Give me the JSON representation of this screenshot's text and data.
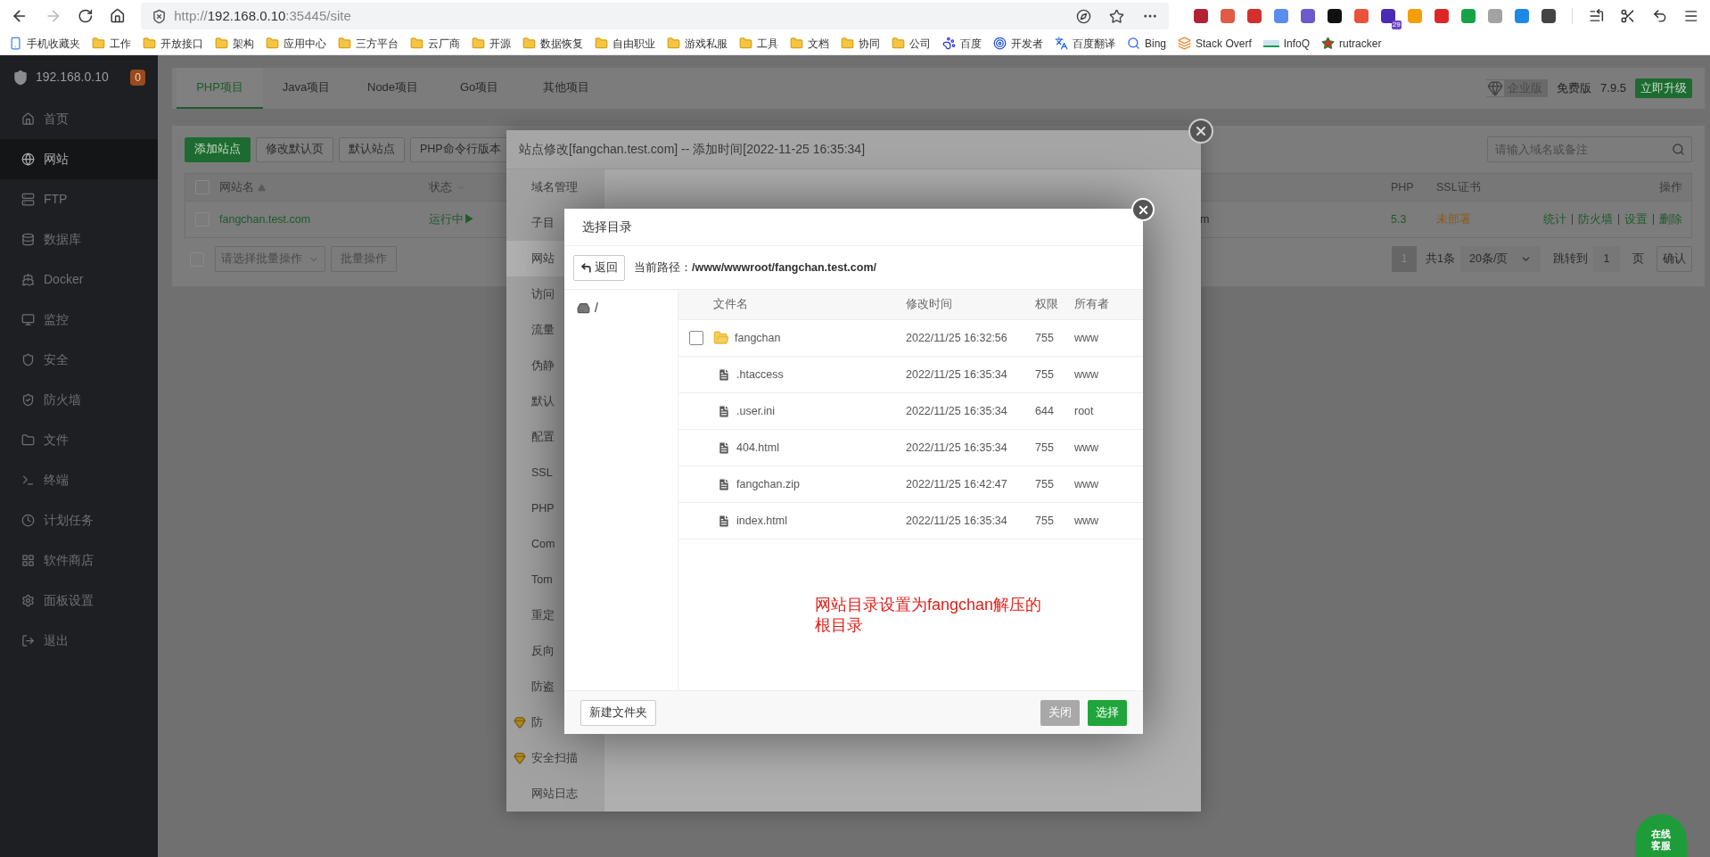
{
  "browser": {
    "url": {
      "scheme": "http://",
      "host": "192.168.0.10",
      "rest": ":35445/site"
    },
    "extension_badge": "29",
    "bookmarks": [
      {
        "label": "手机收藏夹",
        "kind": "device"
      },
      {
        "label": "工作",
        "kind": "folder"
      },
      {
        "label": "开放接口",
        "kind": "folder"
      },
      {
        "label": "架构",
        "kind": "folder"
      },
      {
        "label": "应用中心",
        "kind": "folder"
      },
      {
        "label": "三方平台",
        "kind": "folder"
      },
      {
        "label": "云厂商",
        "kind": "folder"
      },
      {
        "label": "开源",
        "kind": "folder"
      },
      {
        "label": "数据恢复",
        "kind": "folder"
      },
      {
        "label": "自由职业",
        "kind": "folder"
      },
      {
        "label": "游戏私服",
        "kind": "folder"
      },
      {
        "label": "工具",
        "kind": "folder"
      },
      {
        "label": "文档",
        "kind": "folder"
      },
      {
        "label": "协同",
        "kind": "folder"
      },
      {
        "label": "公司",
        "kind": "folder"
      },
      {
        "label": "百度",
        "kind": "paw"
      },
      {
        "label": "开发者",
        "kind": "target"
      },
      {
        "label": "百度翻译",
        "kind": "translate"
      },
      {
        "label": "Bing",
        "kind": "search"
      },
      {
        "label": "Stack Overf",
        "kind": "stack"
      },
      {
        "label": "InfoQ",
        "kind": "infoq"
      },
      {
        "label": "rutracker",
        "kind": "star"
      }
    ]
  },
  "sidebar": {
    "host": "192.168.0.10",
    "badge": "0",
    "items": [
      {
        "label": "首页",
        "selected": false
      },
      {
        "label": "网站",
        "selected": true
      },
      {
        "label": "FTP",
        "selected": false
      },
      {
        "label": "数据库",
        "selected": false
      },
      {
        "label": "Docker",
        "selected": false
      },
      {
        "label": "监控",
        "selected": false
      },
      {
        "label": "安全",
        "selected": false
      },
      {
        "label": "防火墙",
        "selected": false
      },
      {
        "label": "文件",
        "selected": false
      },
      {
        "label": "终端",
        "selected": false
      },
      {
        "label": "计划任务",
        "selected": false
      },
      {
        "label": "软件商店",
        "selected": false
      },
      {
        "label": "面板设置",
        "selected": false
      },
      {
        "label": "退出",
        "selected": false
      }
    ]
  },
  "tabs": [
    {
      "label": "PHP项目",
      "selected": true
    },
    {
      "label": "Java项目",
      "selected": false
    },
    {
      "label": "Node项目",
      "selected": false
    },
    {
      "label": "Go项目",
      "selected": false
    },
    {
      "label": "其他项目",
      "selected": false
    }
  ],
  "edition": {
    "tag": "企业版",
    "plan": "免费版",
    "version": "7.9.5",
    "upgrade": "立即升级"
  },
  "toolbar": {
    "buttons": [
      {
        "label": "添加站点",
        "kind": "primary"
      },
      {
        "label": "修改默认页",
        "kind": "default"
      },
      {
        "label": "默认站点",
        "kind": "default"
      },
      {
        "label": "PHP命令行版本",
        "kind": "default"
      }
    ],
    "search": {
      "placeholder": "请输入域名或备注"
    }
  },
  "sites_table": {
    "header_checked": false,
    "columns": {
      "name": "网站名",
      "status": "状态",
      "php": "PHP",
      "ssl": "SSL证书",
      "actions": "操作"
    },
    "rows": [
      {
        "checked": false,
        "name": "fangchan.test.com",
        "status": "运行中▶",
        "column_3": "m",
        "php": "5.3",
        "ssl": "未部署",
        "actions": [
          "统计",
          "防火墙",
          "设置",
          "删除"
        ]
      }
    ],
    "batch": {
      "checked": false,
      "select": "请选择批量操作",
      "button": "批量操作"
    },
    "pagination": {
      "current": "1",
      "total": "共1条",
      "page_size": "20条/页",
      "jump_label": "跳转到",
      "jump_value": "1",
      "page_unit": "页",
      "confirm": "确认"
    }
  },
  "site_dialog": {
    "title": "站点修改[fangchan.test.com] -- 添加时间[2022-11-25 16:35:34]",
    "menu": [
      {
        "label": "域名管理",
        "selected": false,
        "premium": false
      },
      {
        "label": "子目",
        "selected": false,
        "premium": false
      },
      {
        "label": "网站",
        "selected": true,
        "premium": false
      },
      {
        "label": "访问",
        "selected": false,
        "premium": false
      },
      {
        "label": "流量",
        "selected": false,
        "premium": false
      },
      {
        "label": "伪静",
        "selected": false,
        "premium": false
      },
      {
        "label": "默认",
        "selected": false,
        "premium": false
      },
      {
        "label": "配置",
        "selected": false,
        "premium": false
      },
      {
        "label": "SSL",
        "selected": false,
        "premium": false
      },
      {
        "label": "PHP",
        "selected": false,
        "premium": false
      },
      {
        "label": "Com",
        "selected": false,
        "premium": false
      },
      {
        "label": "Tom",
        "selected": false,
        "premium": false
      },
      {
        "label": "重定",
        "selected": false,
        "premium": false
      },
      {
        "label": "反向",
        "selected": false,
        "premium": false
      },
      {
        "label": "防盗",
        "selected": false,
        "premium": false
      },
      {
        "label": "防",
        "selected": false,
        "premium": true
      },
      {
        "label": "安全扫描",
        "selected": false,
        "premium": true
      },
      {
        "label": "网站日志",
        "selected": false,
        "premium": false
      }
    ]
  },
  "dir_dialog": {
    "title": "选择目录",
    "back": "返回",
    "path": "当前路径：**/www/wwwroot/fangchan.test.com/**",
    "tree": [
      {
        "label": "/"
      }
    ],
    "columns": [
      "文件名",
      "修改时间",
      "权限",
      "所有者"
    ],
    "rows": [
      {
        "kind": "folder",
        "checked": false,
        "name": "fangchan",
        "modified": "2022/11/25 16:32:56",
        "perm": "755",
        "owner": "www"
      },
      {
        "kind": "file",
        "name": ".htaccess",
        "modified": "2022/11/25 16:35:34",
        "perm": "755",
        "owner": "www"
      },
      {
        "kind": "file",
        "name": ".user.ini",
        "modified": "2022/11/25 16:35:34",
        "perm": "644",
        "owner": "root"
      },
      {
        "kind": "file",
        "name": "404.html",
        "modified": "2022/11/25 16:35:34",
        "perm": "755",
        "owner": "www"
      },
      {
        "kind": "file",
        "name": "fangchan.zip",
        "modified": "2022/11/25 16:42:47",
        "perm": "755",
        "owner": "www"
      },
      {
        "kind": "file",
        "name": "index.html",
        "modified": "2022/11/25 16:35:34",
        "perm": "755",
        "owner": "www"
      }
    ],
    "annotation": "网站目录设置为fangchan解压的根目录",
    "buttons": [
      {
        "label": "新建文件夹",
        "kind": "default"
      },
      {
        "label": "关闭",
        "kind": "muted"
      },
      {
        "label": "选择",
        "kind": "primary"
      }
    ]
  },
  "support": {
    "label": "在线客服"
  }
}
